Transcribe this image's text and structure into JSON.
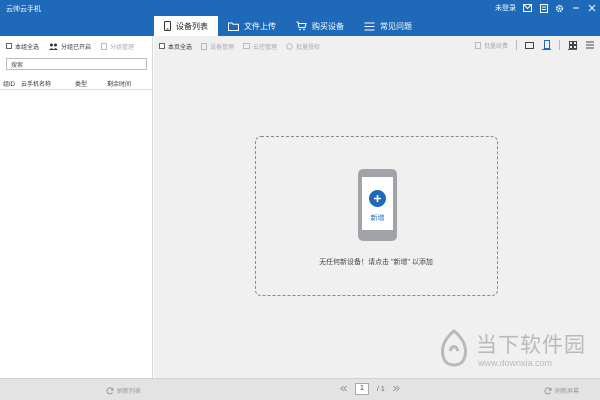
{
  "titlebar": {
    "app_title": "云帅云手机",
    "login": "未登录",
    "tabs": [
      {
        "label": "设备列表",
        "icon": "phone-icon",
        "active": true
      },
      {
        "label": "文件上传",
        "icon": "folder-icon",
        "active": false
      },
      {
        "label": "购买设备",
        "icon": "cart-icon",
        "active": false
      },
      {
        "label": "常见问题",
        "icon": "list-icon",
        "active": false
      }
    ]
  },
  "left": {
    "select_all": "本组全选",
    "group_open": "分组已开启",
    "group_manage": "分组管理",
    "search_value": "搜索",
    "columns": [
      "组ID",
      "云手机名称",
      "类型",
      "剩余时间"
    ]
  },
  "main": {
    "select_page": "本页全选",
    "device_manage": "设备管理",
    "cloud_control": "云控管理",
    "batch_auth": "批量授权",
    "batch_renew": "批量续费",
    "empty": {
      "add_label": "新增",
      "hint": "无任何新设备！请点击 \"新增\" 以添加"
    }
  },
  "statusbar": {
    "refresh_list": "刷新列表",
    "page_current": "1",
    "page_total": "/ 1",
    "refresh_screen": "刷新屏幕"
  },
  "watermark": {
    "text": "当下软件园",
    "url": "www.downxia.com"
  },
  "colors": {
    "brand": "#1e6ab8",
    "panel": "#f0f0f0",
    "statusbar": "#e3e3e3"
  }
}
